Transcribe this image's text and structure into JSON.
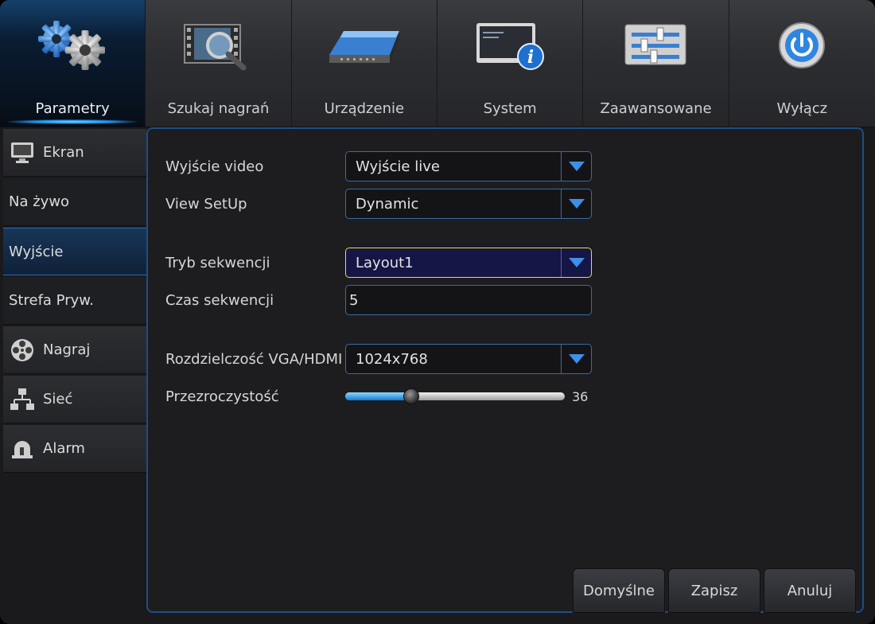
{
  "topnav": {
    "tabs": [
      {
        "label": "Parametry",
        "icon": "gears-icon",
        "active": true
      },
      {
        "label": "Szukaj nagrań",
        "icon": "film-search-icon",
        "active": false
      },
      {
        "label": "Urządzenie",
        "icon": "hard-drive-icon",
        "active": false
      },
      {
        "label": "System",
        "icon": "system-info-icon",
        "active": false
      },
      {
        "label": "Zaawansowane",
        "icon": "sliders-icon",
        "active": false
      },
      {
        "label": "Wyłącz",
        "icon": "power-icon",
        "active": false
      }
    ]
  },
  "sidebar": {
    "items": [
      {
        "label": "Ekran",
        "icon": "monitor-icon"
      },
      {
        "label": "Na żywo"
      },
      {
        "label": "Wyjście",
        "selected": true
      },
      {
        "label": "Strefa Pryw."
      },
      {
        "label": "Nagraj",
        "icon": "film-reel-icon"
      },
      {
        "label": "Sieć",
        "icon": "network-icon"
      },
      {
        "label": "Alarm",
        "icon": "alarm-icon"
      }
    ]
  },
  "form": {
    "video_output": {
      "label": "Wyjście video",
      "value": "Wyjście live"
    },
    "view_setup": {
      "label": "View SetUp",
      "value": "Dynamic"
    },
    "sequence_mode": {
      "label": "Tryb sekwencji",
      "value": "Layout1"
    },
    "sequence_time": {
      "label": "Czas sekwencji",
      "value": "5"
    },
    "resolution": {
      "label": "Rozdzielczość VGA/HDMI",
      "value": "1024x768"
    },
    "transparency": {
      "label": "Przezroczystość",
      "value": "36",
      "fraction": 0.3
    }
  },
  "buttons": {
    "default": "Domyślne",
    "save": "Zapisz",
    "cancel": "Anuluj"
  },
  "colors": {
    "accent": "#1c4f86",
    "focus": "#e8e22a"
  }
}
